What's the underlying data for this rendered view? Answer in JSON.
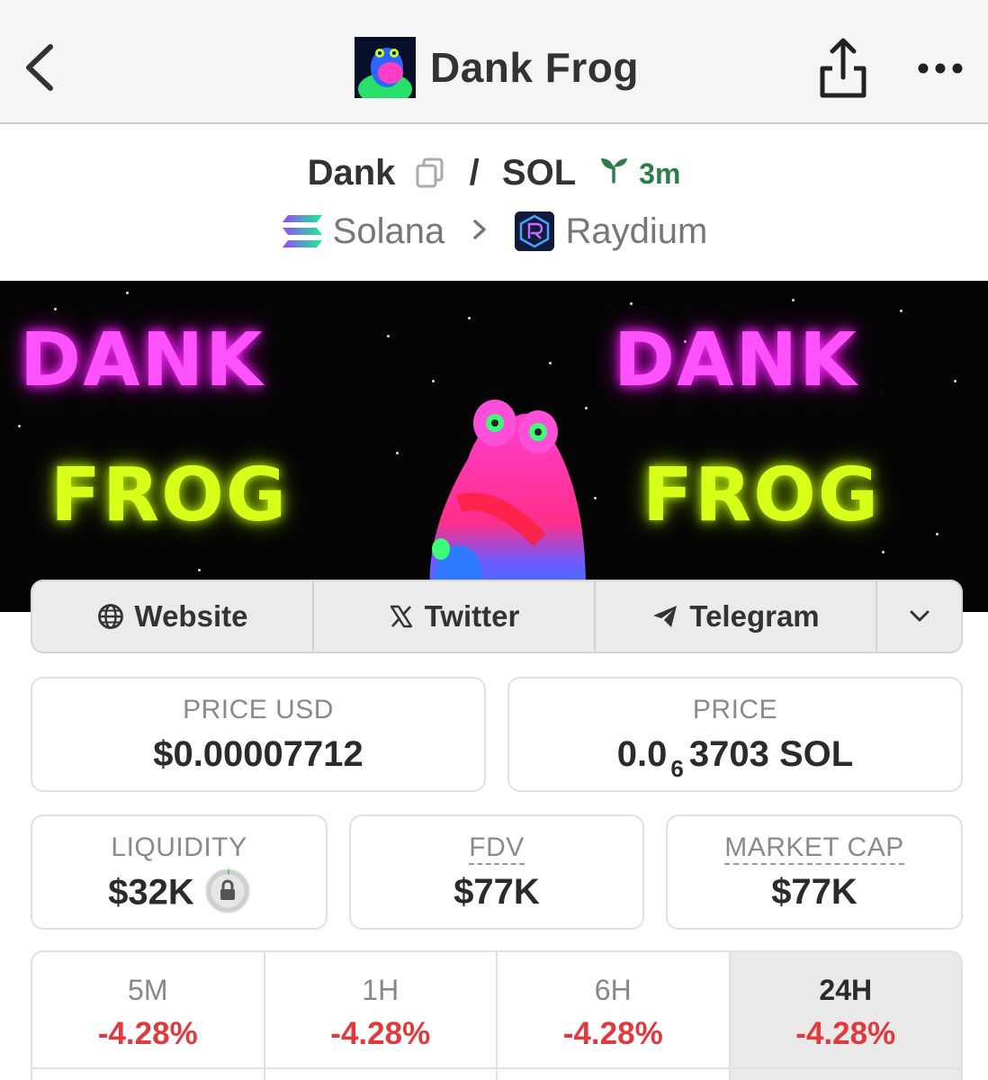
{
  "nav": {
    "title": "Dank Frog"
  },
  "pair": {
    "base": "Dank",
    "quote": "SOL",
    "separator": "/",
    "age": "3m",
    "chain": "Solana",
    "dex": "Raydium"
  },
  "banner": {
    "left_top": "DANK",
    "left_bottom": "FROG",
    "right_top": "DANK",
    "right_bottom": "FROG"
  },
  "links": [
    {
      "label": "Website",
      "icon": "globe-icon"
    },
    {
      "label": "Twitter",
      "icon": "x-logo-icon"
    },
    {
      "label": "Telegram",
      "icon": "telegram-icon"
    }
  ],
  "stats": {
    "price_usd": {
      "label": "PRICE USD",
      "value": "$0.00007712"
    },
    "price_native": {
      "label": "PRICE",
      "prefix": "0.0",
      "zeros": "6",
      "digits": "3703",
      "unit": "SOL"
    },
    "liquidity": {
      "label": "LIQUIDITY",
      "value": "$32K"
    },
    "fdv": {
      "label": "FDV",
      "value": "$77K"
    },
    "market_cap": {
      "label": "MARKET CAP",
      "value": "$77K"
    }
  },
  "changes": [
    {
      "label": "5M",
      "value": "-4.28%"
    },
    {
      "label": "1H",
      "value": "-4.28%"
    },
    {
      "label": "6H",
      "value": "-4.28%"
    },
    {
      "label": "24H",
      "value": "-4.28%",
      "active": true
    }
  ],
  "colors": {
    "negative": "#e0393e",
    "age_green": "#2f7d48",
    "banner_pink": "#ff52ff",
    "banner_lime": "#d8ff1a"
  }
}
